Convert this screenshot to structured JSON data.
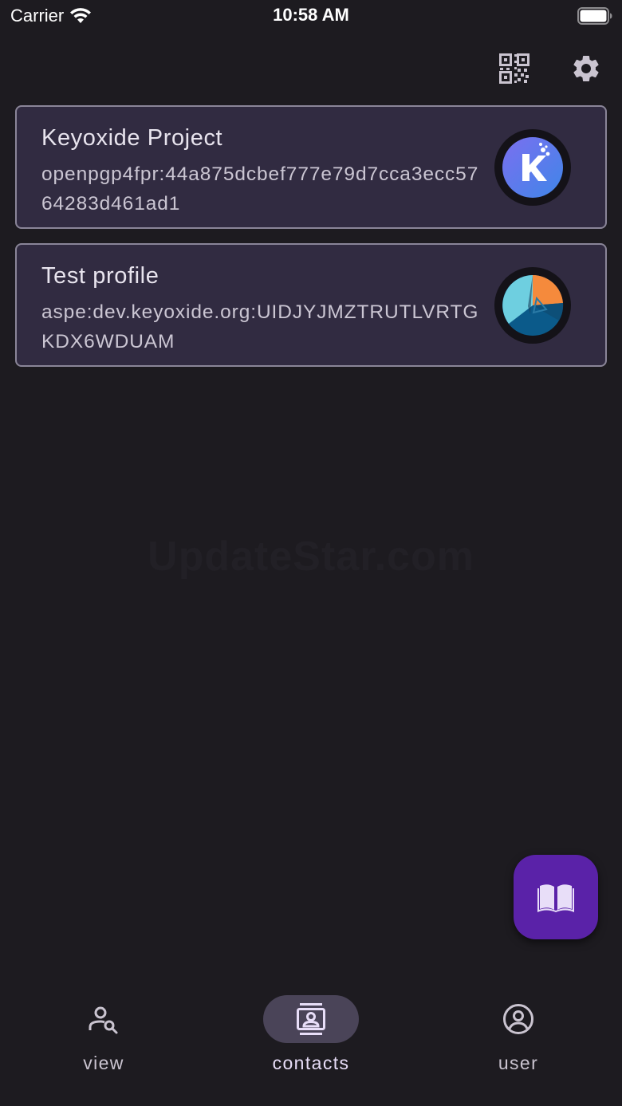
{
  "status_bar": {
    "carrier": "Carrier",
    "time": "10:58 AM"
  },
  "top_bar": {
    "icons": [
      "qr-code-scan-icon",
      "settings-gear-icon"
    ]
  },
  "contacts": [
    {
      "name": "Keyoxide Project",
      "identifier": "openpgp4fpr:44a875dcbef777e79d7cca3ecc5764283d461ad1",
      "avatar": "keyoxide-logo"
    },
    {
      "name": "Test profile",
      "identifier": "aspe:dev.keyoxide.org:UIDJYJMZTRUTLVRTGKDX6WDUAM",
      "avatar": "geometric-pie-avatar"
    }
  ],
  "watermark": "UpdateStar.com",
  "fab": {
    "icon": "open-book-icon",
    "color": "#5a22a8"
  },
  "bottom_nav": {
    "items": [
      {
        "label": "view",
        "icon": "person-search-icon",
        "active": false
      },
      {
        "label": "contacts",
        "icon": "contact-card-icon",
        "active": true
      },
      {
        "label": "user",
        "icon": "account-circle-icon",
        "active": false
      }
    ]
  },
  "colors": {
    "background": "#1d1b20",
    "card": "#312b41",
    "card_border": "#8a8598",
    "active_indicator": "#4a4458"
  }
}
